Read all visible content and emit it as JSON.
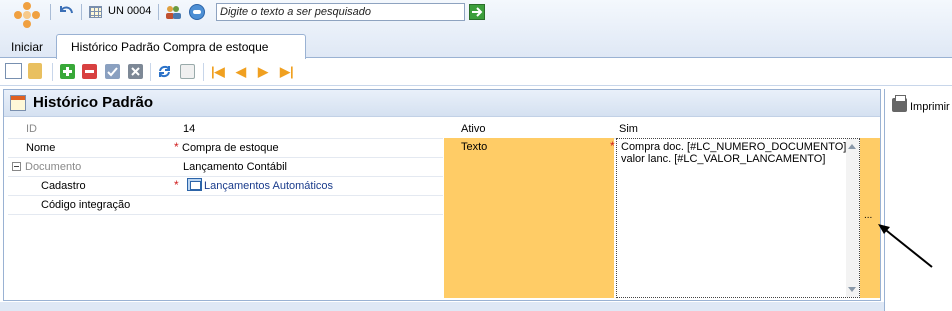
{
  "topbar": {
    "un_label": "UN 0004",
    "search_placeholder": "Digite o texto a ser pesquisado",
    "start_label": "Iniciar"
  },
  "tabs": [
    {
      "label": "Histórico Padrão Compra de estoque"
    }
  ],
  "panel": {
    "title": "Histórico Padrão",
    "fields": {
      "id_label": "ID",
      "id_value": "14",
      "nome_label": "Nome",
      "nome_value": "Compra de estoque",
      "documento_label": "Documento",
      "documento_value": "Lançamento Contábil",
      "cadastro_label": "Cadastro",
      "cadastro_value": "Lançamentos Automáticos",
      "codigo_label": "Código integração",
      "codigo_value": "",
      "ativo_label": "Ativo",
      "ativo_value": "Sim",
      "texto_label": "Texto",
      "texto_line1": "Compra doc. [#LC_NUMERO_DOCUMENTO]",
      "texto_line2": "valor lanc. [#LC_VALOR_LANCAMENTO]"
    },
    "ellipsis": "..."
  },
  "side": {
    "print_label": "Imprimir"
  },
  "colors": {
    "highlight": "#ffcc66",
    "required": "#d02020",
    "link": "#1a3c8c"
  }
}
